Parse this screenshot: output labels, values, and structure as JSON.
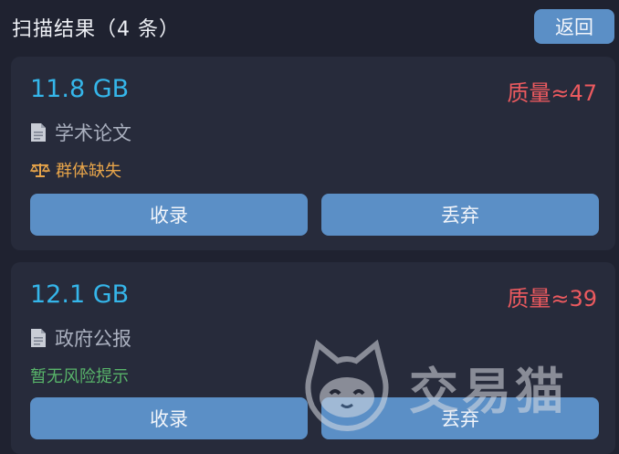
{
  "header": {
    "title": "扫描结果（4 条）",
    "back_label": "返回"
  },
  "results": [
    {
      "size": "11.8 GB",
      "quality": "质量≈47",
      "type": "学术论文",
      "risk": "群体缺失",
      "risk_level": "warning",
      "include_label": "收录",
      "discard_label": "丢弃"
    },
    {
      "size": "12.1 GB",
      "quality": "质量≈39",
      "type": "政府公报",
      "risk": "暂无风险提示",
      "risk_level": "none",
      "include_label": "收录",
      "discard_label": "丢弃"
    }
  ],
  "watermark": {
    "text": "交易猫"
  },
  "colors": {
    "background": "#1f2230",
    "card": "#272b3b",
    "accent_button": "#5b8fc6",
    "size_text": "#35b6ea",
    "quality_text": "#ec5a5f",
    "risk_warning": "#e8a54a",
    "risk_none": "#58b46a"
  },
  "icons": {
    "type_icon": "document-icon",
    "risk_icon": "scale-icon"
  }
}
